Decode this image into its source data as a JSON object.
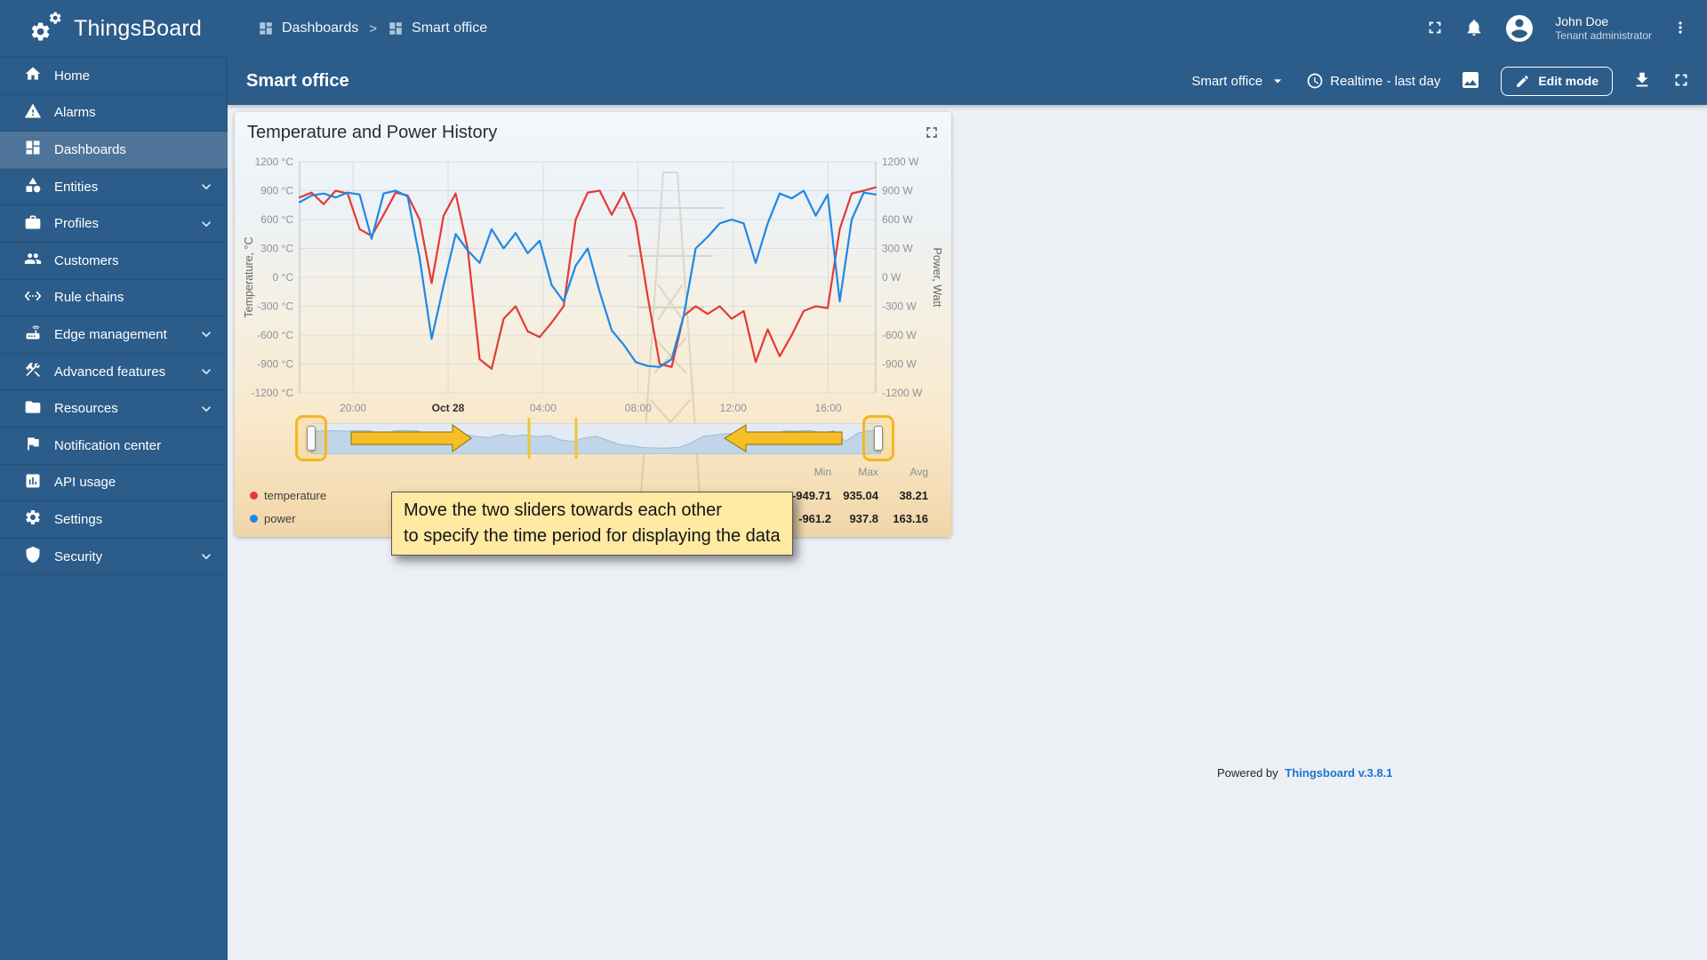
{
  "header": {
    "logo_text": "ThingsBoard",
    "separator": ">",
    "breadcrumbs": [
      {
        "label": "Dashboards"
      },
      {
        "label": "Smart office"
      }
    ],
    "user": {
      "name": "John Doe",
      "role": "Tenant administrator"
    }
  },
  "sidebar": {
    "items": [
      {
        "label": "Home",
        "icon": "home"
      },
      {
        "label": "Alarms",
        "icon": "alarms"
      },
      {
        "label": "Dashboards",
        "icon": "dashboards",
        "active": true
      },
      {
        "label": "Entities",
        "icon": "entities",
        "expandable": true
      },
      {
        "label": "Profiles",
        "icon": "profiles",
        "expandable": true
      },
      {
        "label": "Customers",
        "icon": "customers"
      },
      {
        "label": "Rule chains",
        "icon": "rule-chains"
      },
      {
        "label": "Edge management",
        "icon": "edge",
        "expandable": true
      },
      {
        "label": "Advanced features",
        "icon": "advanced",
        "expandable": true
      },
      {
        "label": "Resources",
        "icon": "resources",
        "expandable": true
      },
      {
        "label": "Notification center",
        "icon": "notification"
      },
      {
        "label": "API usage",
        "icon": "api-usage"
      },
      {
        "label": "Settings",
        "icon": "settings"
      },
      {
        "label": "Security",
        "icon": "security",
        "expandable": true
      }
    ]
  },
  "toolbar": {
    "title": "Smart office",
    "state_selector": "Smart office",
    "time_window": "Realtime - last day",
    "edit_button": "Edit mode"
  },
  "widget": {
    "title": "Temperature and Power History",
    "tooltip": {
      "line1": "Move the two sliders towards each other",
      "line2": "to specify the time period for displaying the data"
    },
    "legend": {
      "columns": [
        "Min",
        "Max",
        "Avg"
      ],
      "rows": [
        {
          "name": "temperature",
          "color": "#e53935",
          "min": "-949.71",
          "max": "935.04",
          "avg": "38.21"
        },
        {
          "name": "power",
          "color": "#1e88e5",
          "min": "-961.2",
          "max": "937.8",
          "avg": "163.16"
        }
      ]
    }
  },
  "chart_data": {
    "type": "line",
    "title": "Temperature and Power History",
    "x_range": [
      0,
      24.25
    ],
    "ylim": [
      -1200,
      1200
    ],
    "yticks": [
      1200,
      900,
      600,
      300,
      0,
      -300,
      -600,
      -900,
      -1200
    ],
    "y_unit_left": "°C",
    "y_unit_right": "W",
    "ylabel_left": "Temperature, °C",
    "ylabel_right": "Power, Watt",
    "grid": true,
    "legend_position": "bottom-left",
    "xticks": [
      {
        "x": 2.25,
        "label": "20:00"
      },
      {
        "x": 6.25,
        "label": "Oct 28",
        "bold": true
      },
      {
        "x": 10.25,
        "label": "04:00"
      },
      {
        "x": 14.25,
        "label": "08:00"
      },
      {
        "x": 18.25,
        "label": "12:00"
      },
      {
        "x": 22.25,
        "label": "16:00"
      }
    ],
    "series": [
      {
        "name": "temperature",
        "color": "#e53935",
        "axis": "left",
        "values": [
          830,
          880,
          760,
          900,
          870,
          500,
          430,
          650,
          880,
          850,
          600,
          -60,
          640,
          870,
          300,
          -850,
          -950,
          -430,
          -300,
          -560,
          -620,
          -470,
          -300,
          600,
          880,
          900,
          650,
          880,
          580,
          -200,
          -900,
          -930,
          -400,
          -300,
          -380,
          -300,
          -430,
          -350,
          -880,
          -540,
          -820,
          -600,
          -350,
          -300,
          -320,
          500,
          870,
          900,
          935
        ]
      },
      {
        "name": "power",
        "color": "#1e88e5",
        "axis": "right",
        "values": [
          780,
          850,
          870,
          830,
          880,
          860,
          400,
          870,
          900,
          840,
          200,
          -640,
          -80,
          450,
          280,
          150,
          500,
          300,
          460,
          250,
          380,
          -80,
          -250,
          120,
          300,
          -150,
          -550,
          -700,
          -880,
          -920,
          -930,
          -850,
          -400,
          300,
          420,
          560,
          600,
          560,
          150,
          560,
          870,
          820,
          900,
          640,
          860,
          -250,
          600,
          880,
          860
        ]
      }
    ]
  },
  "footer": {
    "powered_by": "Powered by",
    "link": "Thingsboard v.3.8.1"
  }
}
